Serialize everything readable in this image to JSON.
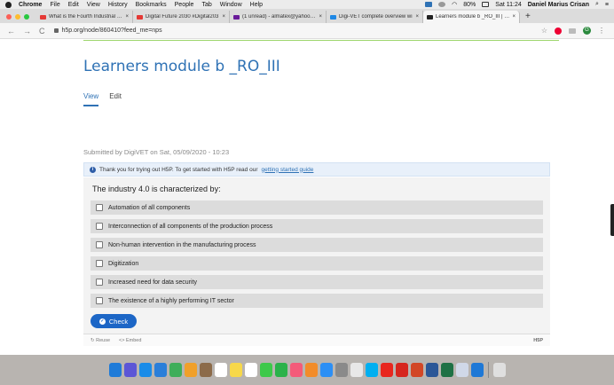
{
  "menubar": {
    "items": [
      "Chrome",
      "File",
      "Edit",
      "View",
      "History",
      "Bookmarks",
      "People",
      "Tab",
      "Window",
      "Help"
    ],
    "battery": "80%",
    "clock": "Sat 11:24",
    "user": "Daniel Marius Crisan"
  },
  "tabs": [
    {
      "label": "What is the Fourth Industrial Re",
      "favicon_color": "#e53935"
    },
    {
      "label": "Digital Future 2030 #Digital203",
      "favicon_color": "#e53935"
    },
    {
      "label": "(1 unread) - almatex@yahoo.co",
      "favicon_color": "#6a1b9a"
    },
    {
      "label": "Digi-VET complete overview wi",
      "favicon_color": "#1e88e5"
    },
    {
      "label": "Learners module b _RO_III | H5",
      "favicon_color": "#222222"
    }
  ],
  "address": {
    "url": "h5p.org/node/860410?feed_me=nps",
    "profile_initial": "G"
  },
  "page": {
    "title": "Learners module b _RO_III",
    "tab_view": "View",
    "tab_edit": "Edit",
    "submitted": "Submitted by DigiVET on Sat, 05/09/2020 - 10:23"
  },
  "h5p": {
    "notice_text": "Thank you for trying out H5P. To get started with H5P read our",
    "notice_link": "getting started guide",
    "question": "The industry 4.0 is characterized by:",
    "options": [
      "Automation of all components",
      "Interconnection of all components of the production process",
      "Non-human intervention in the manufacturing process",
      "Digitization",
      "Increased need for data security",
      "The existence of a highly performing IT sector"
    ],
    "check_label": "Check",
    "reuse_label": "Reuse",
    "embed_label": "Embed",
    "logo": "H5P"
  },
  "dock": {
    "apps": [
      "finder-app",
      "siri-app",
      "safari-app",
      "mail-app",
      "maps-app",
      "photos-app",
      "contacts-app",
      "calendar-app",
      "notes-app",
      "reminders-app",
      "messages-app",
      "facetime-app",
      "music-app",
      "books-app",
      "app-store",
      "system-preferences",
      "chrome-app",
      "skype-app",
      "opera-app",
      "acrobat-app",
      "powerpoint-app",
      "word-app",
      "excel-app",
      "preview-app",
      "screen-sharing-app",
      "trash"
    ],
    "colors": [
      "#1f7bd8",
      "#5c56d6",
      "#1a8ce8",
      "#2b7fd9",
      "#3fae5a",
      "#f0a02a",
      "#8c6b4a",
      "#ffffff",
      "#f7d84a",
      "#ffffff",
      "#3ec94a",
      "#2bb24a",
      "#f45b7a",
      "#f28c2a",
      "#2c8ff5",
      "#8a8a8a",
      "#e8e8e8",
      "#00aff0",
      "#e8261e",
      "#d6261e",
      "#d24726",
      "#2b5797",
      "#1e7145",
      "#d0d8e8",
      "#1e78d6",
      "#dfdfdf"
    ]
  }
}
